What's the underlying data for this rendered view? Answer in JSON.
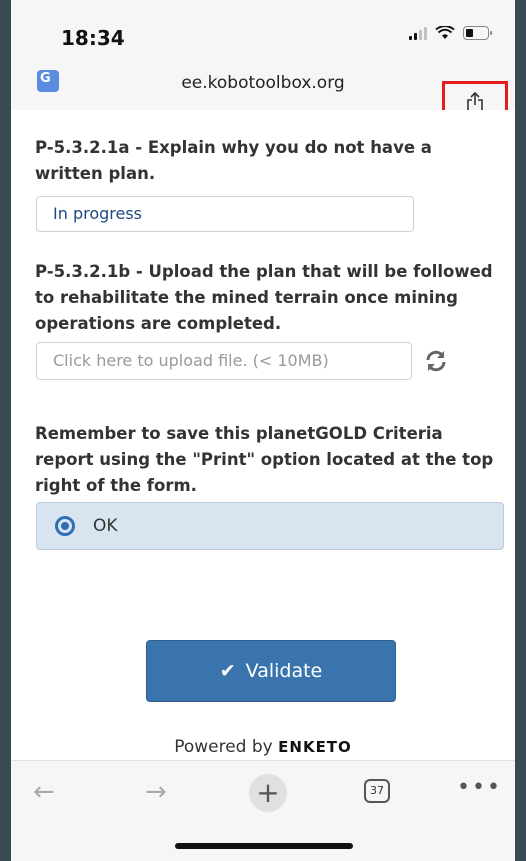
{
  "status_bar": {
    "time": "18:34"
  },
  "browser": {
    "url": "ee.kobotoolbox.org",
    "tab_count": "37"
  },
  "form": {
    "q1_label": "P-5.3.2.1a - Explain why you do not have a written plan.",
    "q1_value": "In progress",
    "q2_label": "P-5.3.2.1b - Upload the plan that will be followed to rehabilitate the mined terrain once mining operations are completed.",
    "q2_placeholder": "Click here to upload file. (< 10MB)",
    "q3_label": "Remember to save this planetGOLD Criteria report using the \"Print\" option located at the top right of the form.",
    "ok_label": "OK",
    "validate_label": "Validate",
    "powered_by": "Powered by",
    "brand": "ENKETO"
  },
  "icons": {
    "translate": "translate-icon",
    "share": "share-icon",
    "refresh": "refresh-icon",
    "check": "check-icon",
    "back": "back-arrow-icon",
    "forward": "forward-arrow-icon",
    "new_tab": "plus-icon",
    "tabs": "tabs-icon",
    "more": "more-icon"
  },
  "colors": {
    "highlight": "#e21d1d",
    "accent": "#3a74ad"
  }
}
